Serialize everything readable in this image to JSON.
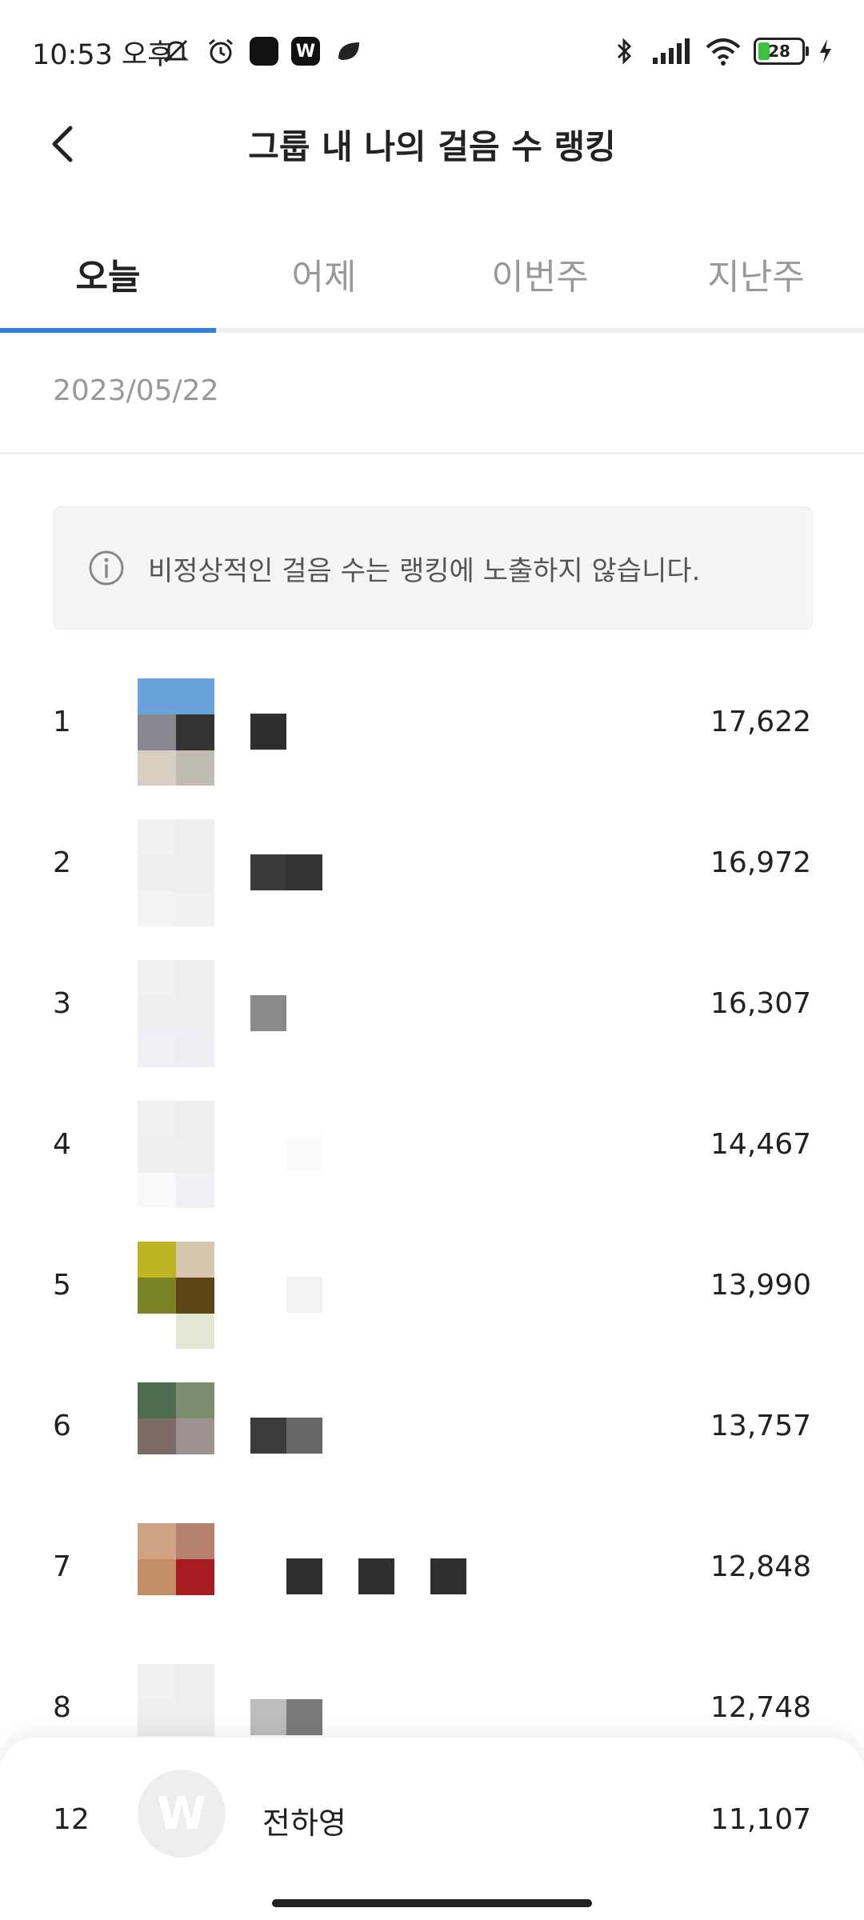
{
  "status_bar": {
    "time": "10:53 오후",
    "battery": "28",
    "icons_left": [
      "mute-icon",
      "alarm-icon",
      "app-black-square-icon",
      "app-w-icon",
      "app-leaf-icon"
    ],
    "icons_right": [
      "bluetooth-icon",
      "signal-icon",
      "wifi-icon",
      "battery-icon",
      "charging-icon"
    ]
  },
  "header": {
    "title": "그룹 내 나의 걸음 수 랭킹"
  },
  "tabs": [
    {
      "label": "오늘",
      "active": true
    },
    {
      "label": "어제",
      "active": false
    },
    {
      "label": "이번주",
      "active": false
    },
    {
      "label": "지난주",
      "active": false
    }
  ],
  "date": "2023/05/22",
  "notice": {
    "text": "비정상적인 걸음 수는 랭킹에 노출하지 않습니다."
  },
  "ranking": [
    {
      "rank": "1",
      "steps": "17,622"
    },
    {
      "rank": "2",
      "steps": "16,972"
    },
    {
      "rank": "3",
      "steps": "16,307"
    },
    {
      "rank": "4",
      "steps": "14,467"
    },
    {
      "rank": "5",
      "steps": "13,990"
    },
    {
      "rank": "6",
      "steps": "13,757"
    },
    {
      "rank": "7",
      "steps": "12,848"
    },
    {
      "rank": "8",
      "steps": "12,748"
    }
  ],
  "my_rank": {
    "rank": "12",
    "name": "전하영",
    "steps": "11,107",
    "avatar_letter": "W"
  },
  "colors": {
    "accent": "#2f7fd6",
    "tab_inactive": "#999999",
    "notice_bg": "#f5f5f5"
  }
}
